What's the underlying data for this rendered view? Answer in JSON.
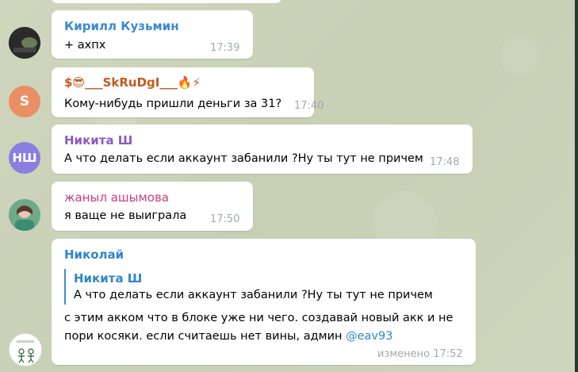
{
  "messages": [
    {
      "sender": "Кирилл Кузьмин",
      "text": "+ ахпх",
      "time": "17:39",
      "name_color": "#3a8ad0"
    },
    {
      "sender": "$😎___SkRuDgI___🔥⚡",
      "text": "Кому-нибудь пришли деньги за 31?",
      "time": "17:40",
      "avatar_letter": "S",
      "avatar_color": "#ea8f63",
      "name_color": "#c05a1e"
    },
    {
      "sender": "Никита Ш",
      "text": "А что делать если аккаунт забанили ?Ну ты тут не причем",
      "time": "17:48",
      "avatar_letter": "НШ",
      "avatar_color": "#8a7fe0",
      "name_color": "#8c59c0"
    },
    {
      "sender": "жаныл ашымова",
      "text": "я ваще не выиграла",
      "time": "17:50",
      "name_color": "#c93d7f"
    },
    {
      "sender": "Николай",
      "name_color": "#2f86c9",
      "reply": {
        "sender": "Никита Ш",
        "text": "А что делать если аккаунт забанили ?Ну ты тут не причем"
      },
      "line1": "с этим акком что в блоке уже ни чего. создавай новый акк и не",
      "line2": "пори косяки. если считаешь нет вины, админ",
      "mention": "@eav93",
      "edited_time": "изменено 17:52"
    }
  ]
}
